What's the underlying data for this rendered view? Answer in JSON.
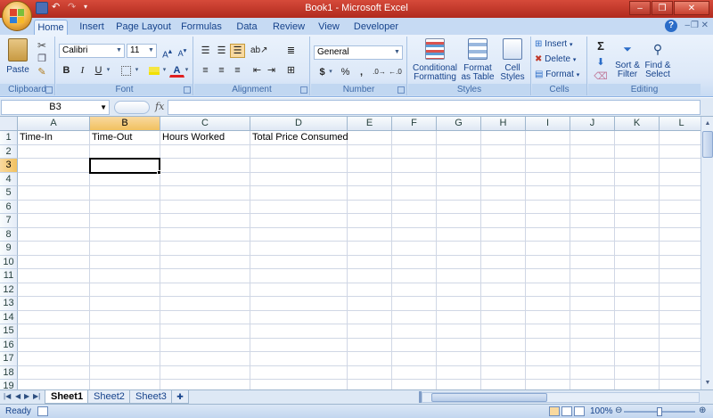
{
  "window": {
    "title": "Book1 - Microsoft Excel",
    "controls": [
      "–",
      "❐",
      "✕"
    ]
  },
  "ribbon_tabs": [
    "Home",
    "Insert",
    "Page Layout",
    "Formulas",
    "Data",
    "Review",
    "View",
    "Developer"
  ],
  "active_tab": "Home",
  "groups": {
    "clipboard": {
      "label": "Clipboard",
      "paste": "Paste"
    },
    "font": {
      "label": "Font",
      "font_name": "Calibri",
      "font_size": "11",
      "bold": "B",
      "italic": "I",
      "underline": "U"
    },
    "alignment": {
      "label": "Alignment"
    },
    "number": {
      "label": "Number",
      "format": "General",
      "currency": "$",
      "percent": "%",
      "comma": ","
    },
    "styles": {
      "label": "Styles",
      "conditional": [
        "Conditional",
        "Formatting"
      ],
      "format_table": [
        "Format",
        "as Table"
      ],
      "cell_styles": [
        "Cell",
        "Styles"
      ]
    },
    "cells": {
      "label": "Cells",
      "insert": "Insert",
      "delete": "Delete",
      "format": "Format"
    },
    "editing": {
      "label": "Editing",
      "sort": [
        "Sort &",
        "Filter"
      ],
      "find": [
        "Find &",
        "Select"
      ]
    }
  },
  "formula_bar": {
    "name_box": "B3",
    "fx": "fx",
    "content": ""
  },
  "columns": [
    "A",
    "B",
    "C",
    "D",
    "E",
    "F",
    "G",
    "H",
    "I",
    "J",
    "K",
    "L"
  ],
  "rows": [
    "1",
    "2",
    "3",
    "4",
    "5",
    "6",
    "7",
    "8",
    "9",
    "10",
    "11",
    "12",
    "13",
    "14",
    "15",
    "16",
    "17",
    "18",
    "19"
  ],
  "cells": {
    "A1": "Time-In",
    "B1": "Time-Out",
    "C1": "Hours Worked",
    "D1": "Total Price Consumed"
  },
  "selected_cell": "B3",
  "sheets": [
    "Sheet1",
    "Sheet2",
    "Sheet3"
  ],
  "active_sheet": "Sheet1",
  "status": {
    "text": "Ready",
    "zoom": "100%"
  },
  "colors": {
    "ribbon": "#dce8f8",
    "title": "#c0392b",
    "selected_header": "#f1c15f"
  }
}
